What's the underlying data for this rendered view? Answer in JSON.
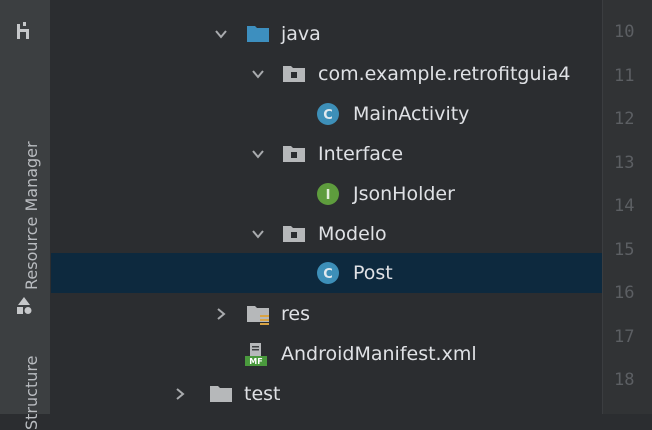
{
  "side_strip": {
    "resource_manager_label": "Resource Manager",
    "structure_label": "Structure",
    "icons": [
      "pull-requests-icon",
      "shapes-icon"
    ]
  },
  "tree": {
    "java": {
      "label": "java",
      "icon": "folder-icon",
      "expanded": true
    },
    "package": {
      "label": "com.example.retrofitguia4",
      "icon": "package-folder-icon",
      "expanded": true
    },
    "main_activity": {
      "label": "MainActivity",
      "icon": "class-icon",
      "badge": "C"
    },
    "interface_pkg": {
      "label": "Interface",
      "icon": "package-folder-icon",
      "expanded": true
    },
    "json_holder": {
      "label": "JsonHolder",
      "icon": "interface-icon",
      "badge": "I"
    },
    "modelo_pkg": {
      "label": "Modelo",
      "icon": "package-folder-icon",
      "expanded": true
    },
    "post": {
      "label": "Post",
      "icon": "class-icon",
      "badge": "C",
      "selected": true
    },
    "res": {
      "label": "res",
      "icon": "resources-folder-icon",
      "expanded": false
    },
    "manifest": {
      "label": "AndroidManifest.xml",
      "icon": "manifest-icon",
      "badge": "MF"
    },
    "test": {
      "label": "test",
      "icon": "folder-icon",
      "expanded": false
    }
  },
  "gutter": {
    "line_numbers": [
      "10",
      "11",
      "12",
      "13",
      "14",
      "15",
      "16",
      "17",
      "18"
    ]
  },
  "colors": {
    "background": "#2b2d30",
    "selection": "#0d293e",
    "text": "#dfe1e5",
    "class_icon": "#3d8fb8",
    "interface_icon": "#5e9c3d",
    "folder_blue": "#3d8fbf",
    "folder_gray": "#b6b8ba"
  }
}
